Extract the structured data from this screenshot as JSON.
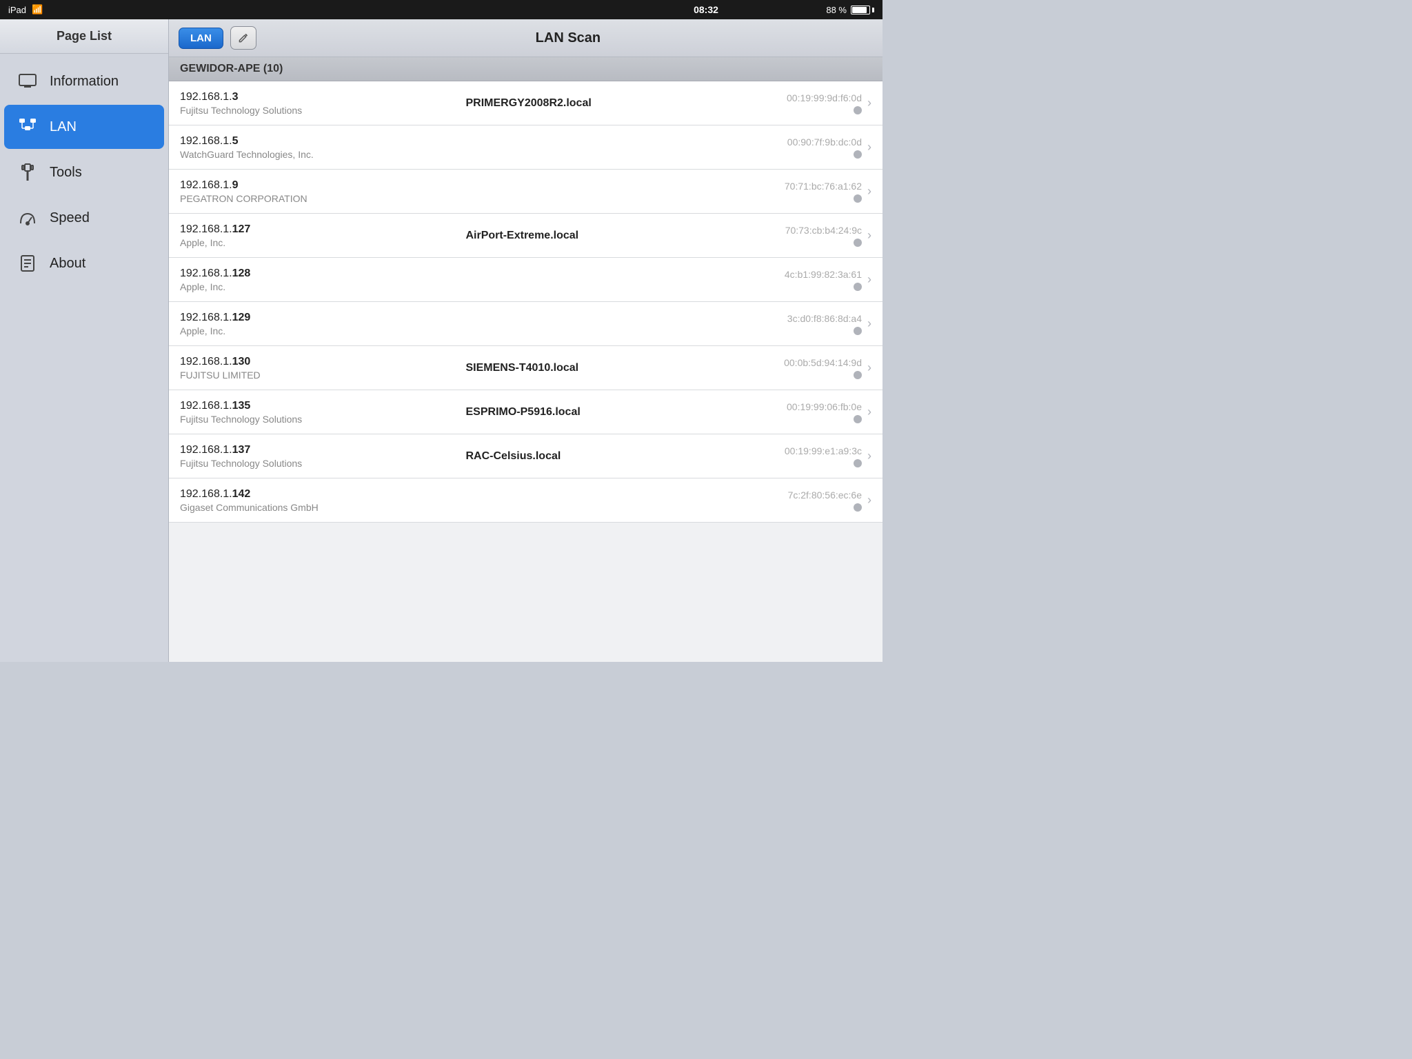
{
  "statusBar": {
    "device": "iPad",
    "wifi": "wifi",
    "time": "08:32",
    "battery": "88 %"
  },
  "sidebar": {
    "title": "Page List",
    "items": [
      {
        "id": "information",
        "label": "Information",
        "icon": "monitor"
      },
      {
        "id": "lan",
        "label": "LAN",
        "icon": "lan",
        "active": true
      },
      {
        "id": "tools",
        "label": "Tools",
        "icon": "tools"
      },
      {
        "id": "speed",
        "label": "Speed",
        "icon": "speed"
      },
      {
        "id": "about",
        "label": "About",
        "icon": "about"
      }
    ]
  },
  "toolbar": {
    "lanButton": "LAN",
    "title": "LAN Scan"
  },
  "sectionHeader": "GEWIDOR-APE (10)",
  "devices": [
    {
      "ip": "192.168.1.",
      "ipSuffix": "3",
      "hostname": "PRIMERGY2008R2.local",
      "vendor": "Fujitsu Technology Solutions",
      "mac": "00:19:99:9d:f6:0d"
    },
    {
      "ip": "192.168.1.",
      "ipSuffix": "5",
      "hostname": "",
      "vendor": "WatchGuard Technologies, Inc.",
      "mac": "00:90:7f:9b:dc:0d"
    },
    {
      "ip": "192.168.1.",
      "ipSuffix": "9",
      "hostname": "",
      "vendor": "PEGATRON CORPORATION",
      "mac": "70:71:bc:76:a1:62"
    },
    {
      "ip": "192.168.1.",
      "ipSuffix": "127",
      "hostname": "AirPort-Extreme.local",
      "vendor": "Apple, Inc.",
      "mac": "70:73:cb:b4:24:9c"
    },
    {
      "ip": "192.168.1.",
      "ipSuffix": "128",
      "hostname": "",
      "vendor": "Apple, Inc.",
      "mac": "4c:b1:99:82:3a:61"
    },
    {
      "ip": "192.168.1.",
      "ipSuffix": "129",
      "hostname": "",
      "vendor": "Apple, Inc.",
      "mac": "3c:d0:f8:86:8d:a4"
    },
    {
      "ip": "192.168.1.",
      "ipSuffix": "130",
      "hostname": "SIEMENS-T4010.local",
      "vendor": "FUJITSU LIMITED",
      "mac": "00:0b:5d:94:14:9d"
    },
    {
      "ip": "192.168.1.",
      "ipSuffix": "135",
      "hostname": "ESPRIMO-P5916.local",
      "vendor": "Fujitsu Technology Solutions",
      "mac": "00:19:99:06:fb:0e"
    },
    {
      "ip": "192.168.1.",
      "ipSuffix": "137",
      "hostname": "RAC-Celsius.local",
      "vendor": "Fujitsu Technology Solutions",
      "mac": "00:19:99:e1:a9:3c"
    },
    {
      "ip": "192.168.1.",
      "ipSuffix": "142",
      "hostname": "",
      "vendor": "Gigaset Communications GmbH",
      "mac": "7c:2f:80:56:ec:6e"
    }
  ]
}
